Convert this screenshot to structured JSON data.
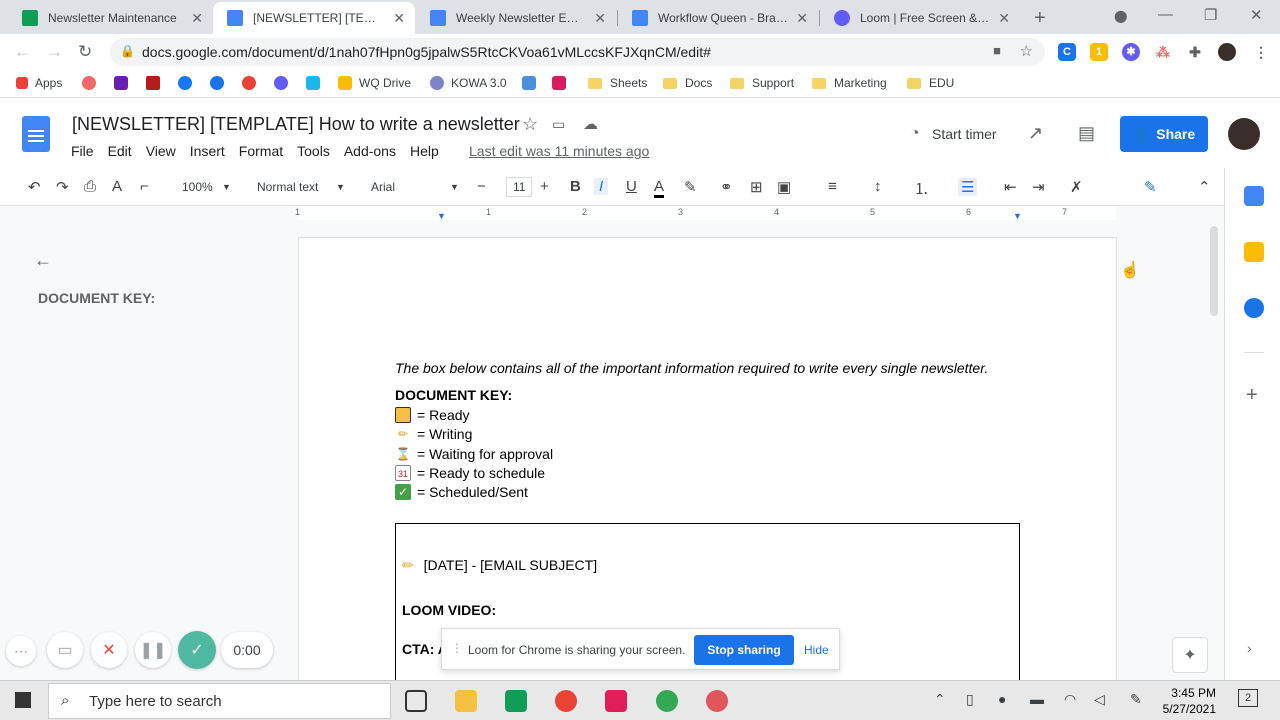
{
  "tabs": [
    {
      "title": "Newsletter Maintenance",
      "color": "#0f9d58"
    },
    {
      "title": "[NEWSLETTER] [TEMPLATE",
      "color": "#4285f4"
    },
    {
      "title": "Weekly Newsletter Emails",
      "color": "#4285f4"
    },
    {
      "title": "Workflow Queen - Brand G",
      "color": "#4285f4"
    },
    {
      "title": "Loom | Free Screen & Vide",
      "color": "#625df5"
    }
  ],
  "url": "docs.google.com/document/d/1nah07fHpn0g5jpalwS5RtcCKVoa61vMLccsKFJXqnCM/edit#",
  "bookmarks": [
    "Apps",
    "WQ Drive",
    "KOWA 3.0",
    "Sheets",
    "Docs",
    "Support",
    "Marketing",
    "EDU"
  ],
  "doc": {
    "title": "[NEWSLETTER] [TEMPLATE] How to write a newsletter",
    "menus": [
      "File",
      "Edit",
      "View",
      "Insert",
      "Format",
      "Tools",
      "Add-ons",
      "Help"
    ],
    "last_edit": "Last edit was 11 minutes ago",
    "start_timer": "Start timer",
    "share": "Share"
  },
  "toolbar": {
    "zoom": "100%",
    "style": "Normal text",
    "font": "Arial",
    "size": "11"
  },
  "ruler": [
    "1",
    "1",
    "2",
    "3",
    "4",
    "5",
    "6",
    "7"
  ],
  "outline": {
    "title": "DOCUMENT KEY:"
  },
  "page": {
    "intro": "The box below contains all of the important information required to write every single newsletter.",
    "key_title": "DOCUMENT KEY:",
    "key_items": [
      "= Ready",
      "= Writing",
      "= Waiting for approval",
      "= Ready to schedule",
      "= Scheduled/Sent"
    ],
    "box_subject": "[DATE] - [EMAIL SUBJECT]",
    "box_loom": "LOOM VIDEO:",
    "box_cta": "CTA:",
    "box_cta_partial": "A"
  },
  "loom": {
    "timer": "0:00",
    "notice": "Loom for Chrome is sharing your screen.",
    "stop": "Stop sharing",
    "hide": "Hide"
  },
  "taskbar": {
    "search": "Type here to search",
    "time": "3:45 PM",
    "date": "5/27/2021",
    "notif": "2"
  }
}
